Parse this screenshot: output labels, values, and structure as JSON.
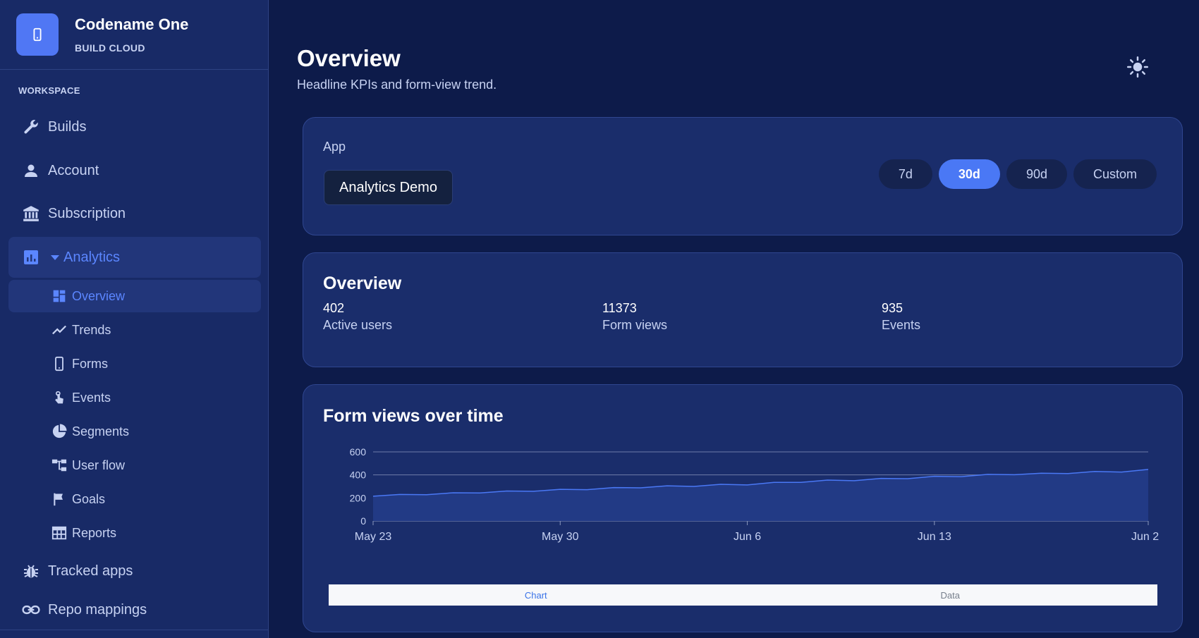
{
  "brand": {
    "name": "Codename One",
    "subtitle": "BUILD CLOUD",
    "icon": "phone-icon"
  },
  "sidebar": {
    "section_label": "WORKSPACE",
    "items": [
      {
        "label": "Builds",
        "icon": "wrench-icon"
      },
      {
        "label": "Account",
        "icon": "person-icon"
      },
      {
        "label": "Subscription",
        "icon": "bank-icon"
      },
      {
        "label": "Analytics",
        "icon": "analytics-icon",
        "expanded": true
      },
      {
        "label": "Tracked apps",
        "icon": "bug-icon"
      },
      {
        "label": "Repo mappings",
        "icon": "link-icon"
      }
    ],
    "sub_items": [
      {
        "label": "Overview",
        "icon": "dashboard-icon",
        "active": true
      },
      {
        "label": "Trends",
        "icon": "trend-icon"
      },
      {
        "label": "Forms",
        "icon": "phone-icon"
      },
      {
        "label": "Events",
        "icon": "touch-icon"
      },
      {
        "label": "Segments",
        "icon": "pie-icon"
      },
      {
        "label": "User flow",
        "icon": "flow-icon"
      },
      {
        "label": "Goals",
        "icon": "flag-icon"
      },
      {
        "label": "Reports",
        "icon": "table-icon"
      }
    ]
  },
  "header": {
    "title": "Overview",
    "subtitle": "Headline KPIs and form-view trend.",
    "theme_icon": "sun-icon"
  },
  "app_filter": {
    "label": "App",
    "selected": "Analytics Demo",
    "ranges": [
      "7d",
      "30d",
      "90d",
      "Custom"
    ],
    "selected_range": "30d"
  },
  "overview": {
    "title": "Overview",
    "kpis": [
      {
        "value": "402",
        "label": "Active users"
      },
      {
        "value": "11373",
        "label": "Form views"
      },
      {
        "value": "935",
        "label": "Events"
      }
    ]
  },
  "chart_section": {
    "title": "Form views over time",
    "tabs": [
      "Chart",
      "Data"
    ],
    "selected_tab": "Chart"
  },
  "chart_data": {
    "type": "area",
    "title": "Form views over time",
    "xlabel": "",
    "ylabel": "",
    "x": [
      "May 23",
      "May 24",
      "May 25",
      "May 26",
      "May 27",
      "May 28",
      "May 29",
      "May 30",
      "May 31",
      "Jun 1",
      "Jun 2",
      "Jun 3",
      "Jun 4",
      "Jun 5",
      "Jun 6",
      "Jun 7",
      "Jun 8",
      "Jun 9",
      "Jun 10",
      "Jun 11",
      "Jun 12",
      "Jun 13",
      "Jun 14",
      "Jun 15",
      "Jun 16",
      "Jun 17",
      "Jun 18",
      "Jun 19",
      "Jun 20",
      "Jun 21"
    ],
    "x_tick_labels": [
      "May 23",
      "May 30",
      "Jun 6",
      "Jun 13",
      "Jun 2"
    ],
    "y_ticks": [
      0,
      200,
      400,
      600
    ],
    "series": [
      {
        "values": [
          215,
          230,
          228,
          245,
          243,
          260,
          258,
          275,
          272,
          290,
          288,
          305,
          300,
          318,
          313,
          335,
          335,
          355,
          350,
          370,
          367,
          388,
          385,
          405,
          402,
          415,
          412,
          430,
          425,
          448
        ]
      }
    ],
    "ylim": [
      0,
      600
    ],
    "grid": true,
    "line_color": "#4a78f5",
    "fill_color": "#223a85"
  }
}
